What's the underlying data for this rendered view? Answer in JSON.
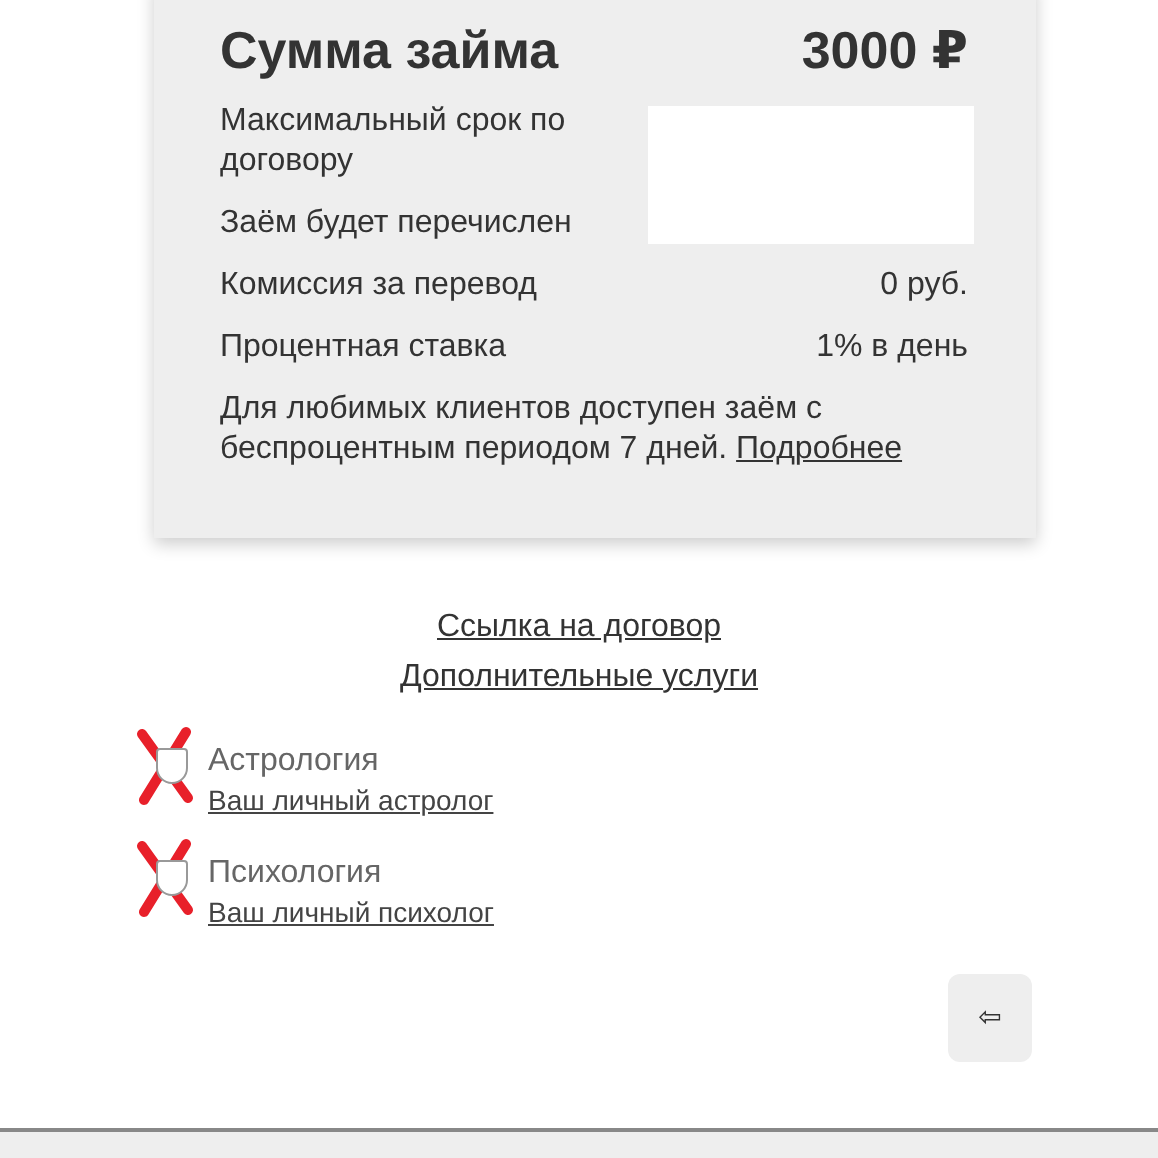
{
  "loan_card": {
    "title": "Сумма займа",
    "amount": "3000 ₽",
    "rows": [
      {
        "label": "Максимальный срок по договору",
        "redacted": true
      },
      {
        "label": "Заём будет перечислен",
        "redacted": true
      },
      {
        "label": "Комиссия за перевод",
        "value": "0 руб."
      },
      {
        "label": "Процентная ставка",
        "value": "1% в день"
      }
    ],
    "note": "Для любимых клиентов доступен заём с беспроцентным периодом 7 дней.",
    "note_link": "Подробнее"
  },
  "links": [
    "Ссылка на договор",
    "Дополнительные услуги"
  ],
  "options": [
    {
      "label": "Астрология",
      "sublink": "Ваш личный астролог",
      "checked": false,
      "crossed_out": true
    },
    {
      "label": "Психология",
      "sublink": "Ваш личный психолог",
      "checked": false,
      "crossed_out": true
    }
  ],
  "back_button": "⇦"
}
